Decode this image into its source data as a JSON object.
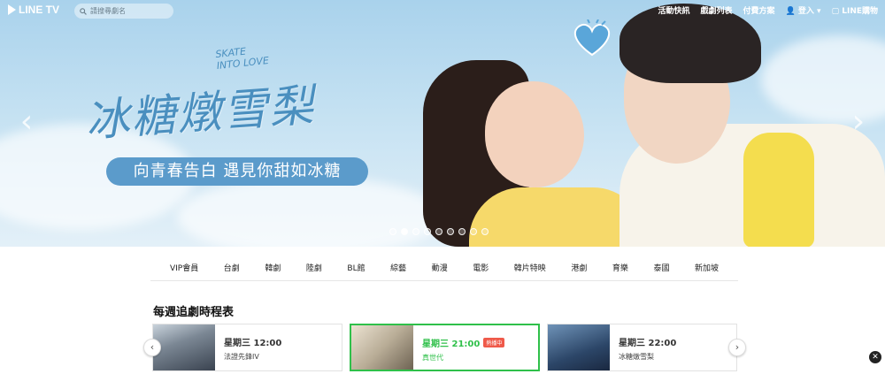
{
  "app": {
    "logo_text": "LINE TV"
  },
  "search": {
    "placeholder": "請搜尋劇名"
  },
  "topnav": {
    "items": [
      "活動快訊",
      "戲劇列表",
      "付費方案",
      "登入",
      "LINE購物"
    ]
  },
  "hero": {
    "title_art": "冰糖燉雪梨",
    "title_en": "SKATE\nINTO LOVE",
    "subtitle": "向青春告白 遇見你甜如冰糖",
    "dots_count": 9,
    "active_dot": 1,
    "prev_icon": "chevron-left-icon",
    "next_icon": "chevron-right-icon"
  },
  "categories": [
    "VIP會員",
    "台劇",
    "韓劇",
    "陸劇",
    "BL館",
    "綜藝",
    "動漫",
    "電影",
    "韓片特映",
    "港劇",
    "育樂",
    "泰國",
    "新加坡"
  ],
  "schedule": {
    "title": "每週追劇時程表",
    "cards": [
      {
        "time": "星期三 12:00",
        "name": "法證先鋒IV",
        "badge": ""
      },
      {
        "time": "星期三 21:00",
        "name": "真世代",
        "badge": "熱播中"
      },
      {
        "time": "星期三 22:00",
        "name": "冰糖燉雪梨",
        "badge": ""
      }
    ]
  },
  "colors": {
    "accent": "#2fc04a",
    "hot_badge": "#ef5a4a",
    "hero_sub_bg": "#5b9bcb"
  }
}
